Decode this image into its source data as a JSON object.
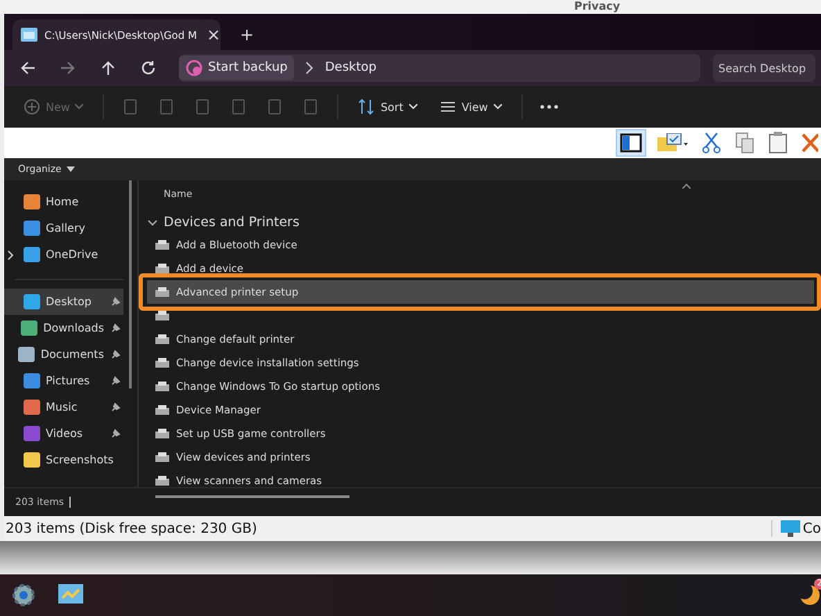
{
  "backdrop": {
    "text": "Privacy"
  },
  "tab": {
    "title": "C:\\Users\\Nick\\Desktop\\God M",
    "close": "×",
    "new_tab": "+"
  },
  "address": {
    "crumbs": [
      "Start backup",
      "Desktop"
    ]
  },
  "search": {
    "placeholder": "Search Desktop"
  },
  "commands": [
    {
      "label": "New",
      "disabled": true
    },
    {
      "label": "Sort",
      "disabled": false
    },
    {
      "label": "View",
      "disabled": false
    }
  ],
  "ribbon": {
    "pane_selected": true
  },
  "organize": "Organize",
  "sidebar": {
    "groups": [
      [
        {
          "label": "Home",
          "selected": false,
          "pinned": false,
          "expandable": false
        },
        {
          "label": "Gallery",
          "selected": false,
          "pinned": false,
          "expandable": false
        },
        {
          "label": "OneDrive",
          "selected": false,
          "pinned": false,
          "expandable": true
        }
      ],
      [
        {
          "label": "Desktop",
          "selected": true,
          "pinned": true,
          "expandable": false
        },
        {
          "label": "Downloads",
          "selected": false,
          "pinned": true,
          "expandable": false
        },
        {
          "label": "Documents",
          "selected": false,
          "pinned": true,
          "expandable": false
        },
        {
          "label": "Pictures",
          "selected": false,
          "pinned": true,
          "expandable": false
        },
        {
          "label": "Music",
          "selected": false,
          "pinned": true,
          "expandable": false
        },
        {
          "label": "Videos",
          "selected": false,
          "pinned": true,
          "expandable": false
        },
        {
          "label": "Screenshots",
          "selected": false,
          "pinned": false,
          "expandable": false
        }
      ]
    ]
  },
  "list": {
    "column": "Name",
    "group": {
      "label": "Devices and Printers",
      "expanded": true
    },
    "items": [
      {
        "label": "Add a Bluetooth device",
        "selected": false
      },
      {
        "label": "Add a device",
        "selected": false
      },
      {
        "label": "Advanced printer setup",
        "selected": true,
        "highlighted": true
      },
      {
        "selected": false
      },
      {
        "label": "Change default printer",
        "selected": false
      },
      {
        "label": "Change device installation settings",
        "selected": false
      },
      {
        "label": "Change Windows To Go startup options",
        "selected": false
      },
      {
        "label": "Device Manager",
        "selected": false
      },
      {
        "label": "Set up USB game controllers",
        "selected": false
      },
      {
        "label": "View devices and printers",
        "selected": false
      },
      {
        "label": "View scanners and cameras",
        "selected": false
      }
    ]
  },
  "status": "203 items",
  "legacy_status": {
    "text": "203 items (Disk free space: 230 GB)",
    "computer": "Co"
  },
  "taskbar": {
    "badge": "2"
  }
}
